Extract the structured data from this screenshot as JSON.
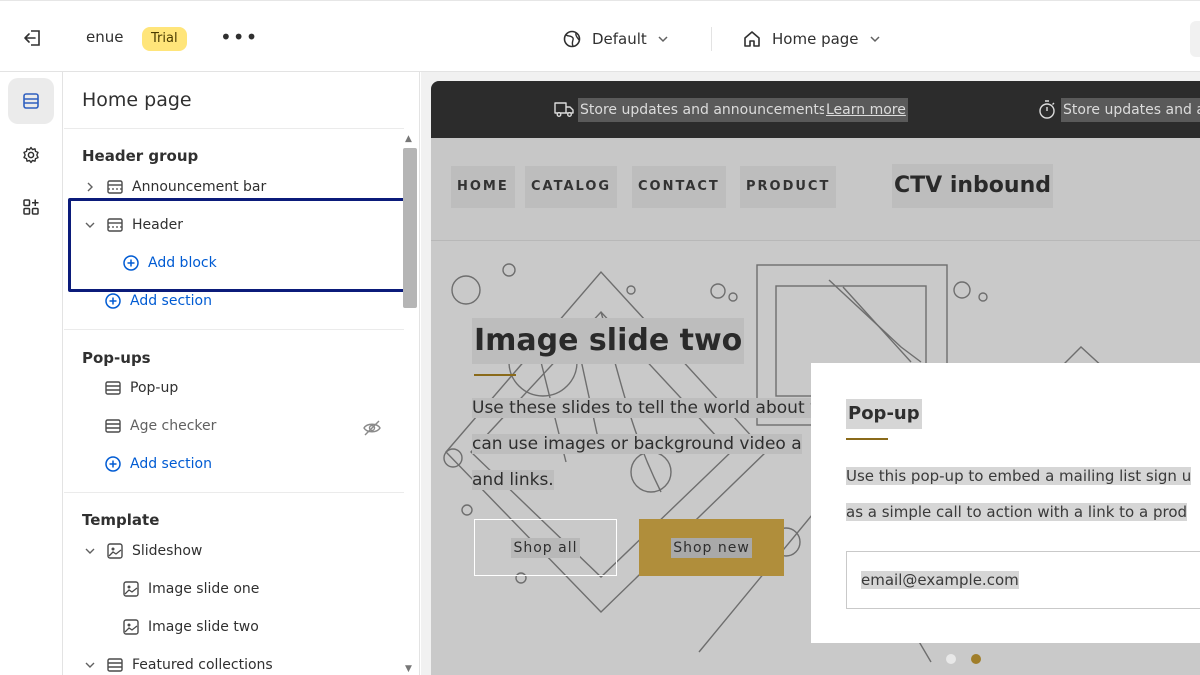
{
  "topbar": {
    "store_name": "enue",
    "trial_badge": "Trial",
    "more": "•••",
    "theme_label": "Default",
    "page_label": "Home page"
  },
  "rail": {
    "icons": [
      "sections-icon",
      "gear-icon",
      "apps-icon"
    ]
  },
  "sidebar": {
    "title": "Home page",
    "header_group": {
      "title": "Header group",
      "items": [
        {
          "label": "Announcement bar"
        },
        {
          "label": "Header"
        }
      ],
      "add_block": "Add block",
      "add_section": "Add section"
    },
    "popups": {
      "title": "Pop-ups",
      "items": [
        {
          "label": "Pop-up"
        },
        {
          "label": "Age checker"
        }
      ],
      "add_section": "Add section"
    },
    "template": {
      "title": "Template",
      "items": [
        {
          "label": "Slideshow"
        },
        {
          "label": "Image slide one"
        },
        {
          "label": "Image slide two"
        },
        {
          "label": "Featured collections"
        }
      ]
    }
  },
  "preview": {
    "announcement": {
      "text": "Store updates and announcements",
      "link": "Learn more",
      "text_repeat": "Store updates and a"
    },
    "nav": {
      "items": [
        "HOME",
        "CATALOG",
        "CONTACT",
        "PRODUCT"
      ],
      "brand": "CTV inbound"
    },
    "hero": {
      "title": "Image slide two",
      "body_lines": [
        "Use these slides to tell the world about y",
        "can use images or background video a",
        "and links."
      ],
      "button_outline": "Shop all",
      "button_gold": "Shop new"
    },
    "popup": {
      "title": "Pop-up",
      "body_lines": [
        "Use this pop-up to embed a mailing list sign u",
        "as a simple call to action with a link to a prod"
      ],
      "email_value": "email@example.com"
    },
    "colors": {
      "accent_gold": "#b08e3b",
      "link_blue": "#005bd3",
      "highlight_navy": "#0b1b7a"
    }
  }
}
